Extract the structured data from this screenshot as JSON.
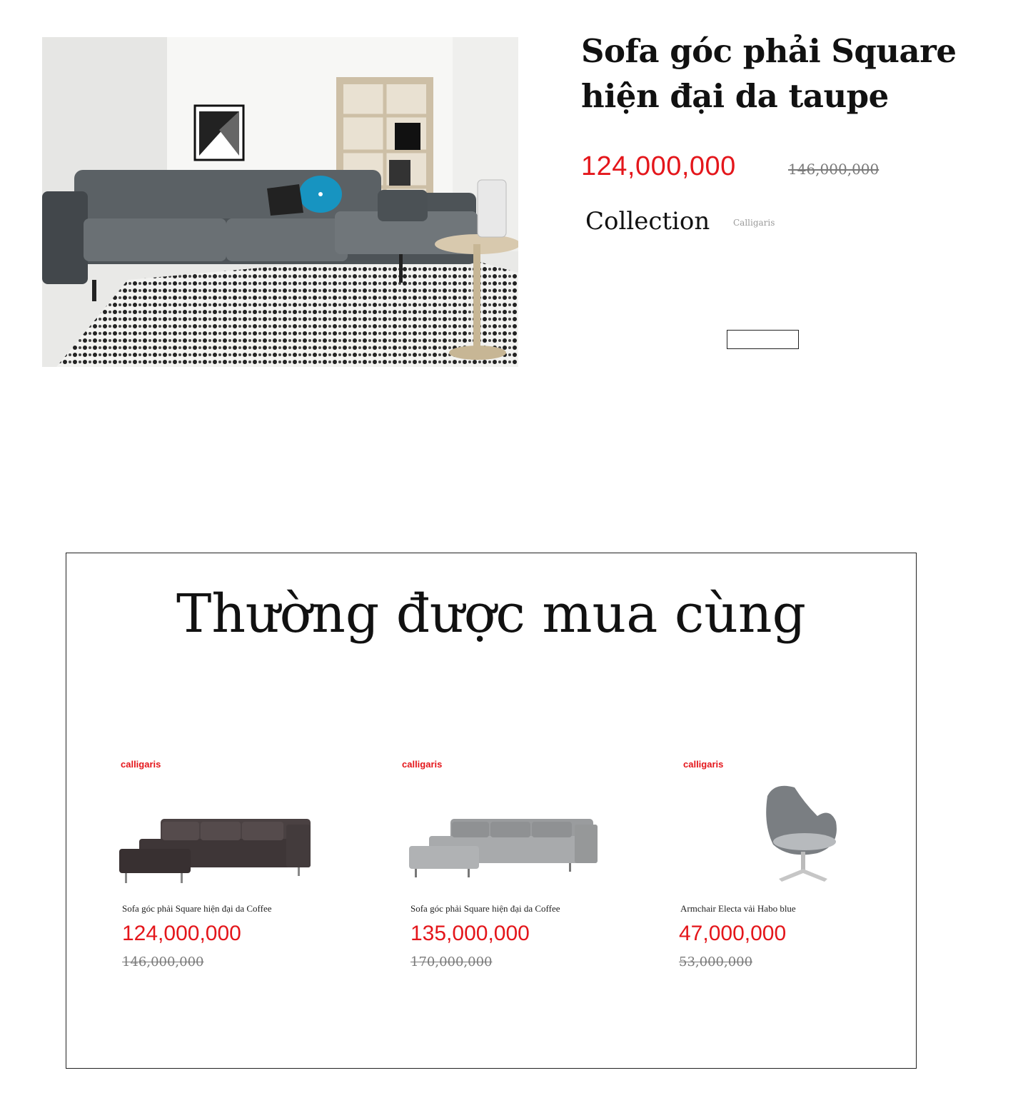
{
  "product": {
    "title": "Sofa góc phải Square hiện đại da taupe",
    "price": "124,000,000",
    "old_price": "146,000,000",
    "collection_label": "Collection",
    "collection_value": "Calligaris",
    "image_icon": "living-room-sofa-photo"
  },
  "related": {
    "heading": "Thường được mua cùng",
    "items": [
      {
        "brand": "calligaris",
        "name": "Sofa góc phải Square hiện đại da Coffee",
        "price": "124,000,000",
        "old_price": "146,000,000",
        "image_icon": "dark-brown-corner-sofa"
      },
      {
        "brand": "calligaris",
        "name": "Sofa góc phải Square hiện đại da Coffee",
        "price": "135,000,000",
        "old_price": "170,000,000",
        "image_icon": "grey-corner-sofa"
      },
      {
        "brand": "calligaris",
        "name": "Armchair Electa vải Habo blue",
        "price": "47,000,000",
        "old_price": "53,000,000",
        "image_icon": "grey-lounge-chair"
      }
    ]
  },
  "colors": {
    "price_red": "#e4161b",
    "old_price_grey": "#7a7a7a",
    "text": "#111111"
  }
}
